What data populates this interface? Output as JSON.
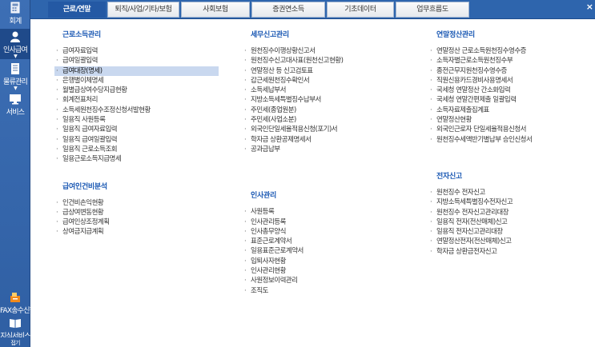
{
  "sidebar": {
    "items": [
      {
        "label": "회계",
        "icon": "calculator-icon"
      },
      {
        "label": "인사급여",
        "icon": "user-icon"
      },
      {
        "label": "물류관리",
        "icon": "document-icon"
      },
      {
        "label": "서비스",
        "icon": "monitor-icon"
      },
      {
        "label": "FAX송수신함",
        "icon": "fax-icon"
      },
      {
        "label": "지식서비스",
        "icon": "book-icon"
      }
    ],
    "footer": "접기"
  },
  "tabs": [
    "근로/연말",
    "퇴직/사업/기타/보험",
    "사회보험",
    "증권연소득",
    "기초데이터",
    "업무흐름도"
  ],
  "colors": {
    "accent": "#2459a4",
    "section_title": "#1a58b3",
    "selected_row": "#c9d8ef"
  },
  "columns": [
    {
      "sections": [
        {
          "title": "근로소득관리",
          "items": [
            "급여자료입력",
            "급여일괄입력",
            "급여대장(명세)",
            "은행별이체명세",
            "월별급상여수당지급현황",
            "회계전표처리",
            "소득세원천징수조정신청서발현황",
            "일용직 사원등록",
            "일용직 급여자료입력",
            "일용직 급여일괄입력",
            "일용직 근로소득조회",
            "일용근로소득지급명세"
          ]
        },
        {
          "title": "급여인건비분석",
          "items": [
            "인건비손익현황",
            "급상여변동현황",
            "급여인상조정계획",
            "상여금지급계획"
          ]
        }
      ]
    },
    {
      "sections": [
        {
          "title": "세무신고관리",
          "items": [
            "원천징수이행상황신고서",
            "원천징수신고대사표(원천신고현황)",
            "연말정산 등 신고검토표",
            "갑근세원천징수확인서",
            "소득세납부서",
            "지방소득세특별징수납부서",
            "주민세(종업원분)",
            "주민세(사업소분)",
            "외국인단일세율적용신청(포기)서",
            "학자금 상환공제명세서",
            "공과금납부"
          ]
        },
        {
          "title": "인사관리",
          "items": [
            "사원등록",
            "인사관리등록",
            "인사총무양식",
            "표준근로계약서",
            "일용표준근로계약서",
            "입퇴사자현황",
            "인사관리현황",
            "사원정보이력관리",
            "조직도"
          ]
        }
      ]
    },
    {
      "sections": [
        {
          "title": "연말정산관리",
          "items": [
            "연말정산 근로소득원천징수영수증",
            "소득자별근로소득원천징수부",
            "종전근무지원천징수영수증",
            "직원신용카드경비사용명세서",
            "국세청 연말정산 간소화입력",
            "국세청 연말간편제출 일괄입력",
            "소득자료제출집계표",
            "연말정산현황",
            "외국인근로자 단일세율적용신청서",
            "원천징수세액반기별납부 승인신청서"
          ]
        },
        {
          "title": "전자신고",
          "items": [
            "원천징수 전자신고",
            "지방소득세특별징수전자신고",
            "원천징수 전자신고관리대장",
            "일용직 전자(전산매체)신고",
            "일용직 전자신고관리대장",
            "연말정산전자(전산매체)신고",
            "학자금 상환금전자신고"
          ]
        }
      ]
    }
  ]
}
